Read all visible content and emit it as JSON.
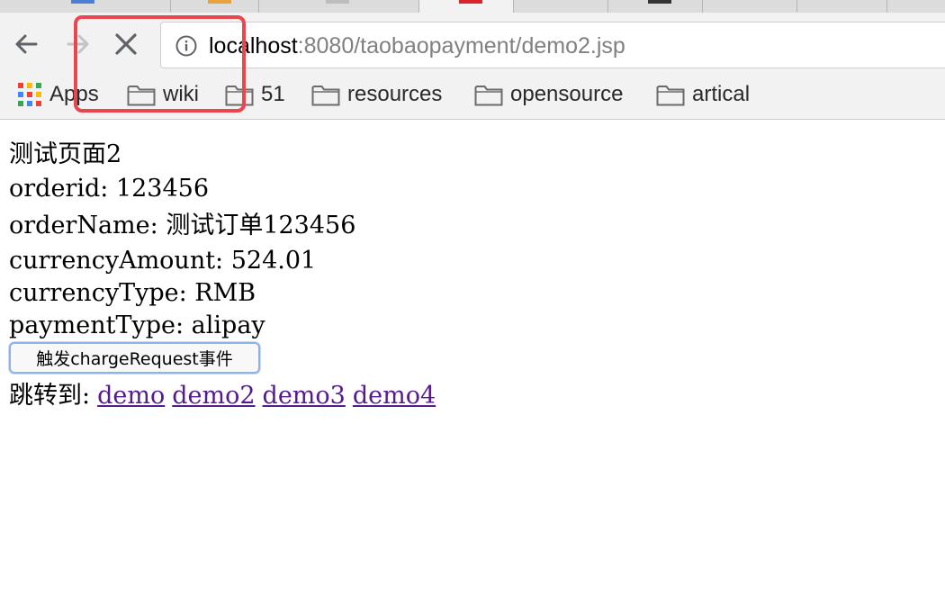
{
  "browser": {
    "url_host": "localhost",
    "url_rest": ":8080/taobaopayment/demo2.jsp",
    "bookmarks": [
      {
        "label": "Apps",
        "icon": "apps-grid-icon"
      },
      {
        "label": "wiki",
        "icon": "folder-icon"
      },
      {
        "label": "51",
        "icon": "folder-icon"
      },
      {
        "label": "resources",
        "icon": "folder-icon"
      },
      {
        "label": "opensource",
        "icon": "folder-icon"
      },
      {
        "label": "artical",
        "icon": "folder-icon"
      }
    ],
    "highlight_color": "#e8474f"
  },
  "page": {
    "title": "测试页面2",
    "fields": [
      {
        "label": "orderid:",
        "value": "123456"
      },
      {
        "label": "orderName:",
        "value": "测试订单123456"
      },
      {
        "label": "currencyAmount:",
        "value": "524.01"
      },
      {
        "label": "currencyType:",
        "value": "RMB"
      },
      {
        "label": "paymentType:",
        "value": "alipay"
      }
    ],
    "charge_button": "触发chargeRequest事件",
    "jump_label": "跳转到:",
    "links": [
      "demo",
      "demo2",
      "demo3",
      "demo4"
    ],
    "link_color": "#551a8b"
  }
}
